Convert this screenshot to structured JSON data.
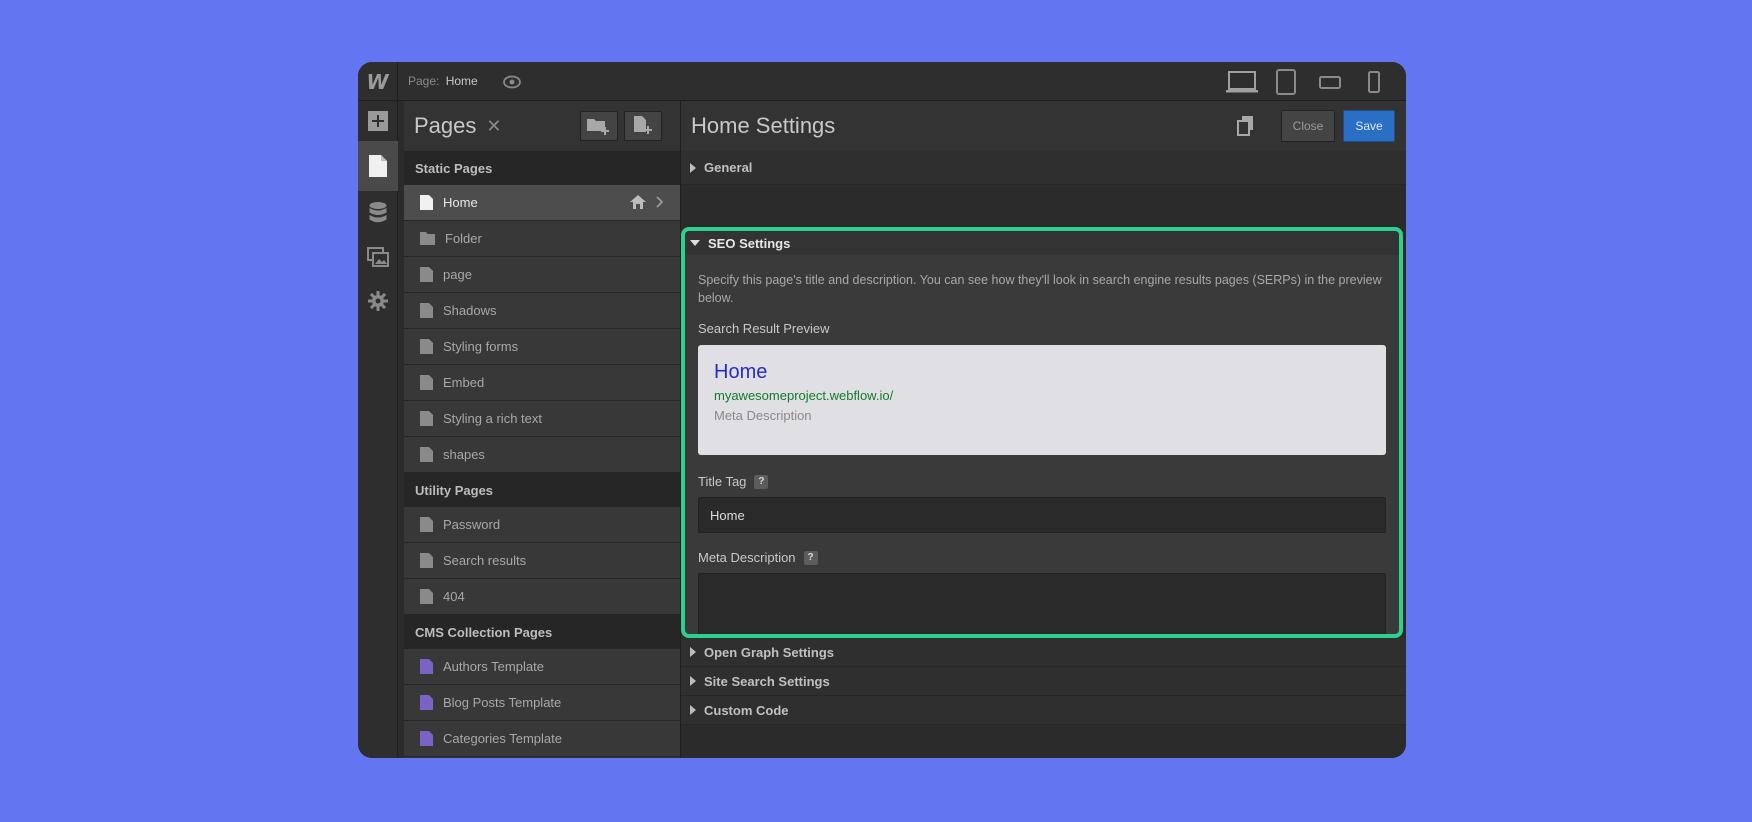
{
  "topbar": {
    "logo": "W",
    "page_prefix": "Page:",
    "page_name": "Home"
  },
  "pages_panel": {
    "title": "Pages",
    "close_glyph": "✕",
    "sections": [
      {
        "label": "Static Pages",
        "items": [
          "Home",
          "Folder",
          "page",
          "Shadows",
          "Styling forms",
          "Embed",
          "Styling a rich text",
          "shapes"
        ]
      },
      {
        "label": "Utility Pages",
        "items": [
          "Password",
          "Search results",
          "404"
        ]
      },
      {
        "label": "CMS Collection Pages",
        "items": [
          "Authors Template",
          "Blog Posts Template",
          "Categories Template"
        ]
      }
    ]
  },
  "main": {
    "title": "Home Settings",
    "close_label": "Close",
    "save_label": "Save",
    "general_label": "General",
    "seo": {
      "label": "SEO Settings",
      "description": "Specify this page's title and description. You can see how they'll look in search engine results pages (SERPs) in the preview below.",
      "preview_label": "Search Result Preview",
      "preview_title": "Home",
      "preview_url": "myawesomeproject.webflow.io/",
      "preview_meta": "Meta Description",
      "title_tag_label": "Title Tag",
      "title_tag_value": "Home",
      "meta_label": "Meta Description",
      "help_glyph": "?"
    },
    "open_graph_label": "Open Graph Settings",
    "site_search_label": "Site Search Settings",
    "custom_code_label": "Custom Code"
  },
  "colors": {
    "background": "#6375f0",
    "highlight": "#2fd08f",
    "save": "#2b6fc4",
    "cms_icon": "#7b63c6"
  }
}
